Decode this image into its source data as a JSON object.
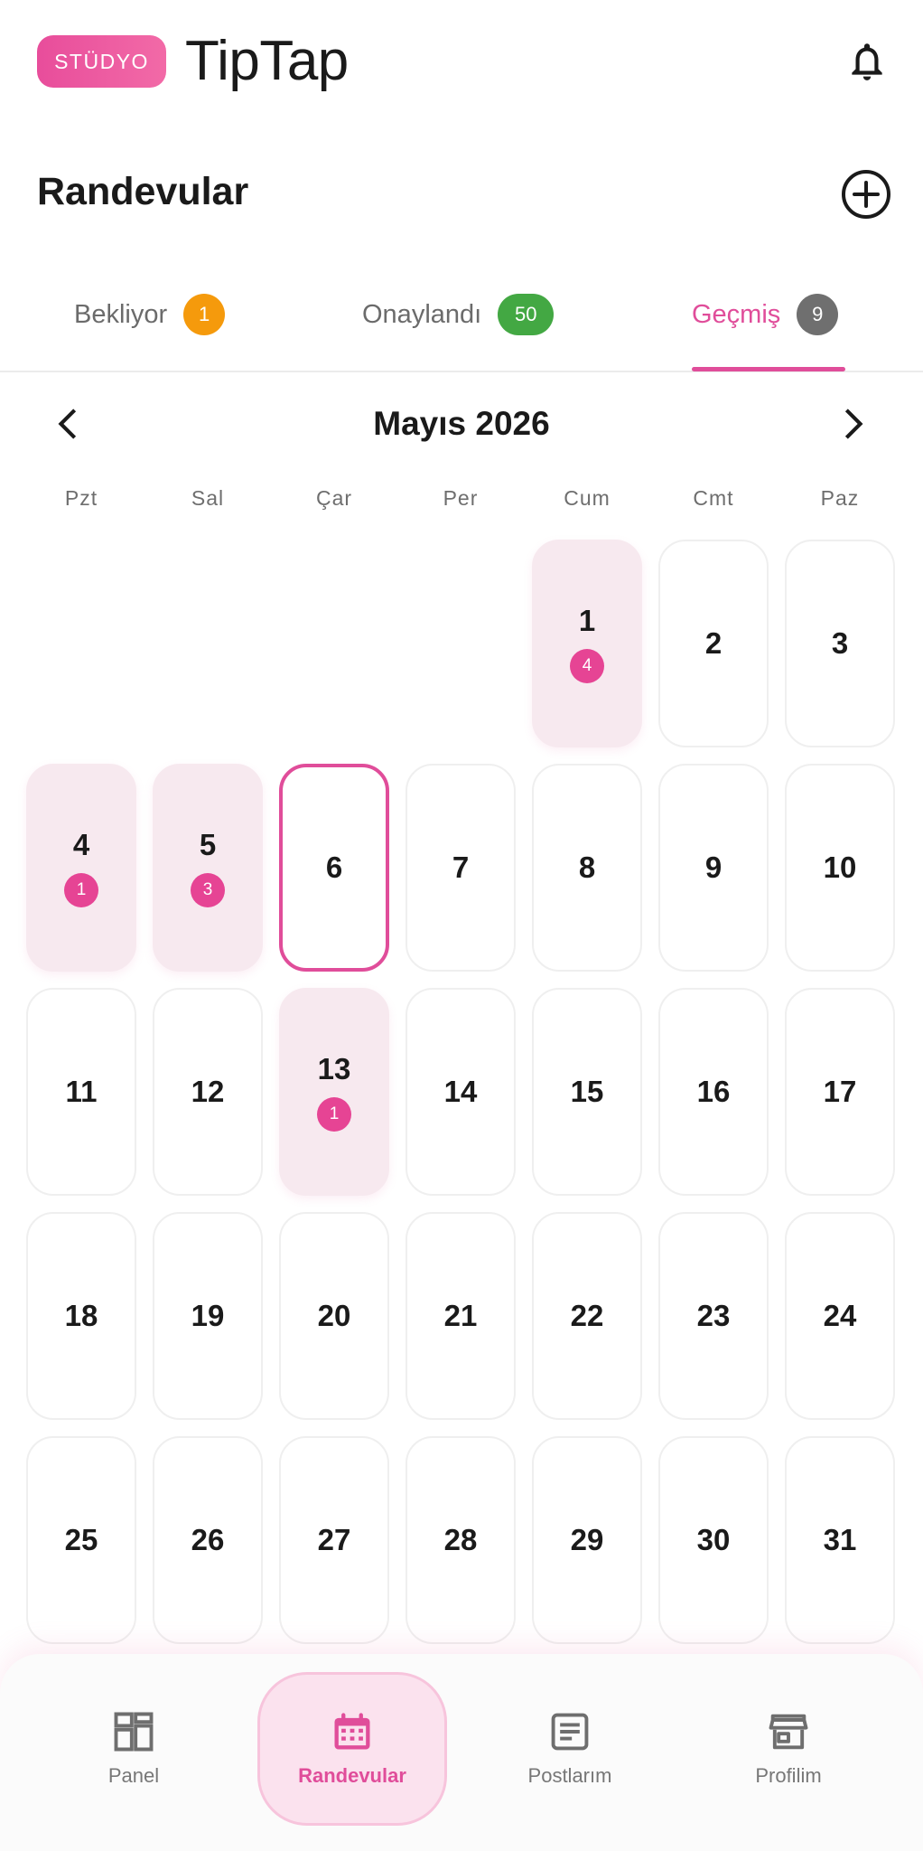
{
  "header": {
    "badge": "STÜDYO",
    "brand": "TipTap"
  },
  "section": {
    "title": "Randevular"
  },
  "tabs": [
    {
      "label": "Bekliyor",
      "count": "1",
      "color": "#f59a0c"
    },
    {
      "label": "Onaylandı",
      "count": "50",
      "color": "#43a843"
    },
    {
      "label": "Geçmiş",
      "count": "9",
      "color": "#6f6f6f",
      "active": true
    }
  ],
  "calendar": {
    "month_title": "Mayıs 2026",
    "weekdays": [
      "Pzt",
      "Sal",
      "Çar",
      "Per",
      "Cum",
      "Cmt",
      "Paz"
    ],
    "first_weekday_index": 4,
    "days": [
      {
        "n": "1",
        "count": "4"
      },
      {
        "n": "2"
      },
      {
        "n": "3"
      },
      {
        "n": "4",
        "count": "1"
      },
      {
        "n": "5",
        "count": "3"
      },
      {
        "n": "6",
        "today": true
      },
      {
        "n": "7"
      },
      {
        "n": "8"
      },
      {
        "n": "9"
      },
      {
        "n": "10"
      },
      {
        "n": "11"
      },
      {
        "n": "12"
      },
      {
        "n": "13",
        "count": "1"
      },
      {
        "n": "14"
      },
      {
        "n": "15"
      },
      {
        "n": "16"
      },
      {
        "n": "17"
      },
      {
        "n": "18"
      },
      {
        "n": "19"
      },
      {
        "n": "20"
      },
      {
        "n": "21"
      },
      {
        "n": "22"
      },
      {
        "n": "23"
      },
      {
        "n": "24"
      },
      {
        "n": "25"
      },
      {
        "n": "26"
      },
      {
        "n": "27"
      },
      {
        "n": "28"
      },
      {
        "n": "29"
      },
      {
        "n": "30"
      },
      {
        "n": "31"
      }
    ]
  },
  "bottom_nav": [
    {
      "label": "Panel",
      "icon": "dashboard-icon"
    },
    {
      "label": "Randevular",
      "icon": "calendar-icon",
      "active": true
    },
    {
      "label": "Postlarım",
      "icon": "article-icon"
    },
    {
      "label": "Profilim",
      "icon": "store-icon"
    }
  ],
  "colors": {
    "accent": "#e04d9a",
    "pending": "#f59a0c",
    "confirmed": "#43a843",
    "history": "#6f6f6f"
  }
}
